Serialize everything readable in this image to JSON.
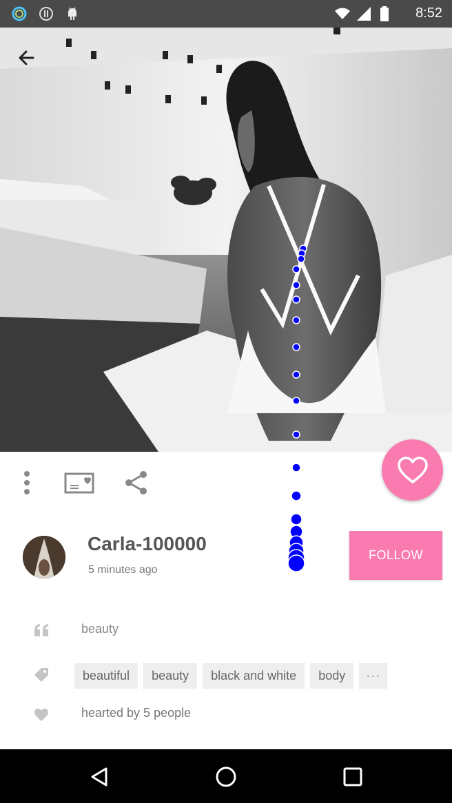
{
  "status_bar": {
    "time": "8:52",
    "icons": [
      "ring-app-icon",
      "info-icon",
      "android-icon"
    ]
  },
  "top_bar": {
    "back_icon": "arrow-left-icon"
  },
  "actions": {
    "more_icon": "more-vertical-icon",
    "card_icon": "postcard-icon",
    "share_icon": "share-icon",
    "heart_icon": "heart-outline-icon"
  },
  "user": {
    "name": "Carla-100000",
    "posted": "5 minutes ago",
    "follow_label": "FOLLOW"
  },
  "post": {
    "caption": "beauty",
    "tags": [
      "beautiful",
      "beauty",
      "black and white",
      "body"
    ],
    "more_tags_label": "···",
    "hearted_text": "hearted by 5 people"
  },
  "nav": {
    "icons": [
      "back-triangle-icon",
      "home-circle-icon",
      "recents-square-icon"
    ]
  },
  "colors": {
    "accent": "#f97bb0",
    "status_bar": "#4a4a4a",
    "overlay_dot": "#0000ff"
  }
}
